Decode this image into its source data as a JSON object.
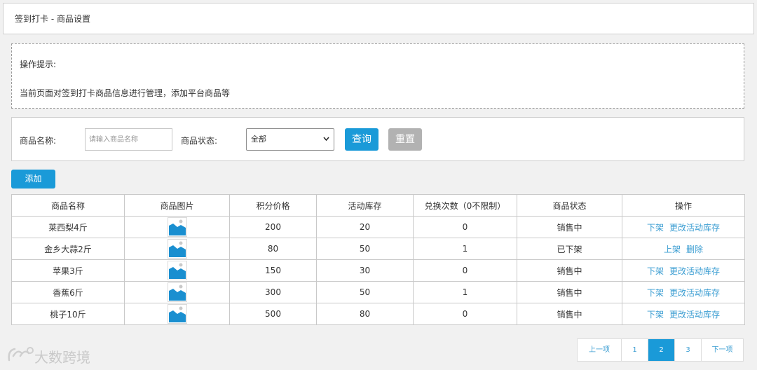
{
  "breadcrumb": "签到打卡 - 商品设置",
  "tips": {
    "title": "操作提示:",
    "text": "当前页面对签到打卡商品信息进行管理，添加平台商品等"
  },
  "search": {
    "name_label": "商品名称:",
    "name_placeholder": "请输入商品名称",
    "status_label": "商品状态:",
    "status_value": "全部",
    "query_label": "查询",
    "reset_label": "重置"
  },
  "add_label": "添加",
  "table": {
    "headers": [
      "商品名称",
      "商品图片",
      "积分价格",
      "活动库存",
      "兑换次数（0不限制）",
      "商品状态",
      "操作"
    ],
    "rows": [
      {
        "name": "莱西梨4斤",
        "price": "200",
        "stock": "20",
        "times": "0",
        "status": "销售中",
        "actions": [
          "下架",
          "更改活动库存"
        ]
      },
      {
        "name": "金乡大蒜2斤",
        "price": "80",
        "stock": "50",
        "times": "1",
        "status": "已下架",
        "actions": [
          "上架",
          "删除"
        ]
      },
      {
        "name": "苹果3斤",
        "price": "150",
        "stock": "30",
        "times": "0",
        "status": "销售中",
        "actions": [
          "下架",
          "更改活动库存"
        ]
      },
      {
        "name": "香蕉6斤",
        "price": "300",
        "stock": "50",
        "times": "1",
        "status": "销售中",
        "actions": [
          "下架",
          "更改活动库存"
        ]
      },
      {
        "name": "桃子10斤",
        "price": "500",
        "stock": "80",
        "times": "0",
        "status": "销售中",
        "actions": [
          "下架",
          "更改活动库存"
        ]
      }
    ]
  },
  "pagination": {
    "prev": "上一项",
    "pages": [
      "1",
      "2",
      "3"
    ],
    "current": "2",
    "next": "下一项"
  },
  "watermark": "大数跨境",
  "colors": {
    "primary": "#1a9ad8",
    "reset": "#b2b2b2",
    "link": "#3a9dd2"
  }
}
